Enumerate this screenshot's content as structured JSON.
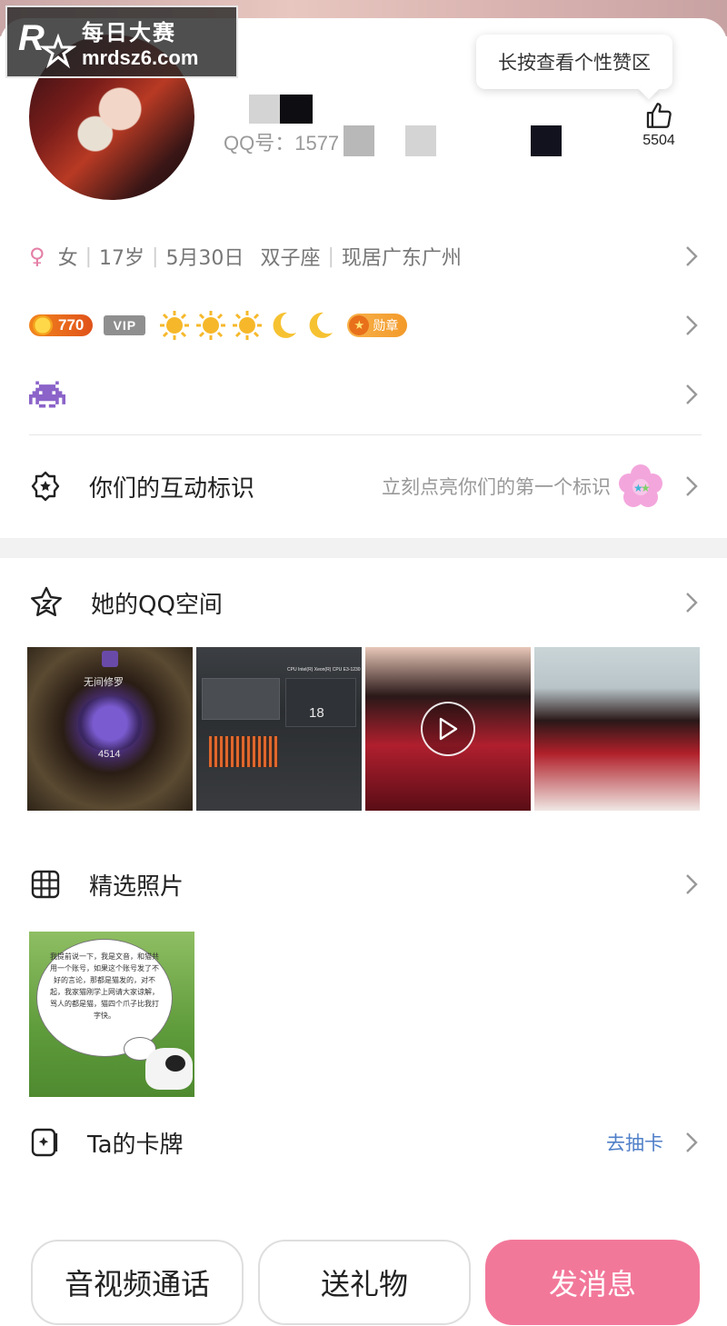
{
  "watermark": {
    "line1": "每日大赛",
    "line2": "mrdsz6.com",
    "logo_text": "每日大赛"
  },
  "profile": {
    "qq_id": "QQ号：1577",
    "tooltip": "长按查看个性赞区",
    "like_count": "5504",
    "gender": "女",
    "age": "17岁",
    "birthday": "5月30日",
    "zodiac": "双子座",
    "location": "现居广东广州"
  },
  "badges": {
    "coin_value": "770",
    "vip_label": "VIP",
    "medal_label": "勋章"
  },
  "interaction": {
    "title": "你们的互动标识",
    "hint": "立刻点亮你们的第一个标识"
  },
  "qzone": {
    "title": "她的QQ空间",
    "photo1_title": "无间修罗",
    "photo1_value": "4514",
    "photo2_value": "18",
    "photo2_line1": "CPU",
    "photo2_line2": "Intel(R) Xeon(R) CPU E3-1230"
  },
  "featured_photos": {
    "title": "精选照片",
    "bubble_text": "我提前说一下，我是文音，和猫共用一个账号，如果这个账号发了不好的言论，那都是猫发的，对不起，我家猫刚学上网请大家谅解，骂人的都是猫，猫四个爪子比我打字快。"
  },
  "cards": {
    "title": "Ta的卡牌",
    "action": "去抽卡"
  },
  "actions": {
    "call": "音视频通话",
    "gift": "送礼物",
    "message": "发消息"
  },
  "colors": {
    "accent": "#f2789a",
    "link": "#4f7fc8",
    "coin": "#f2851e",
    "gender": "#e47fa6"
  }
}
